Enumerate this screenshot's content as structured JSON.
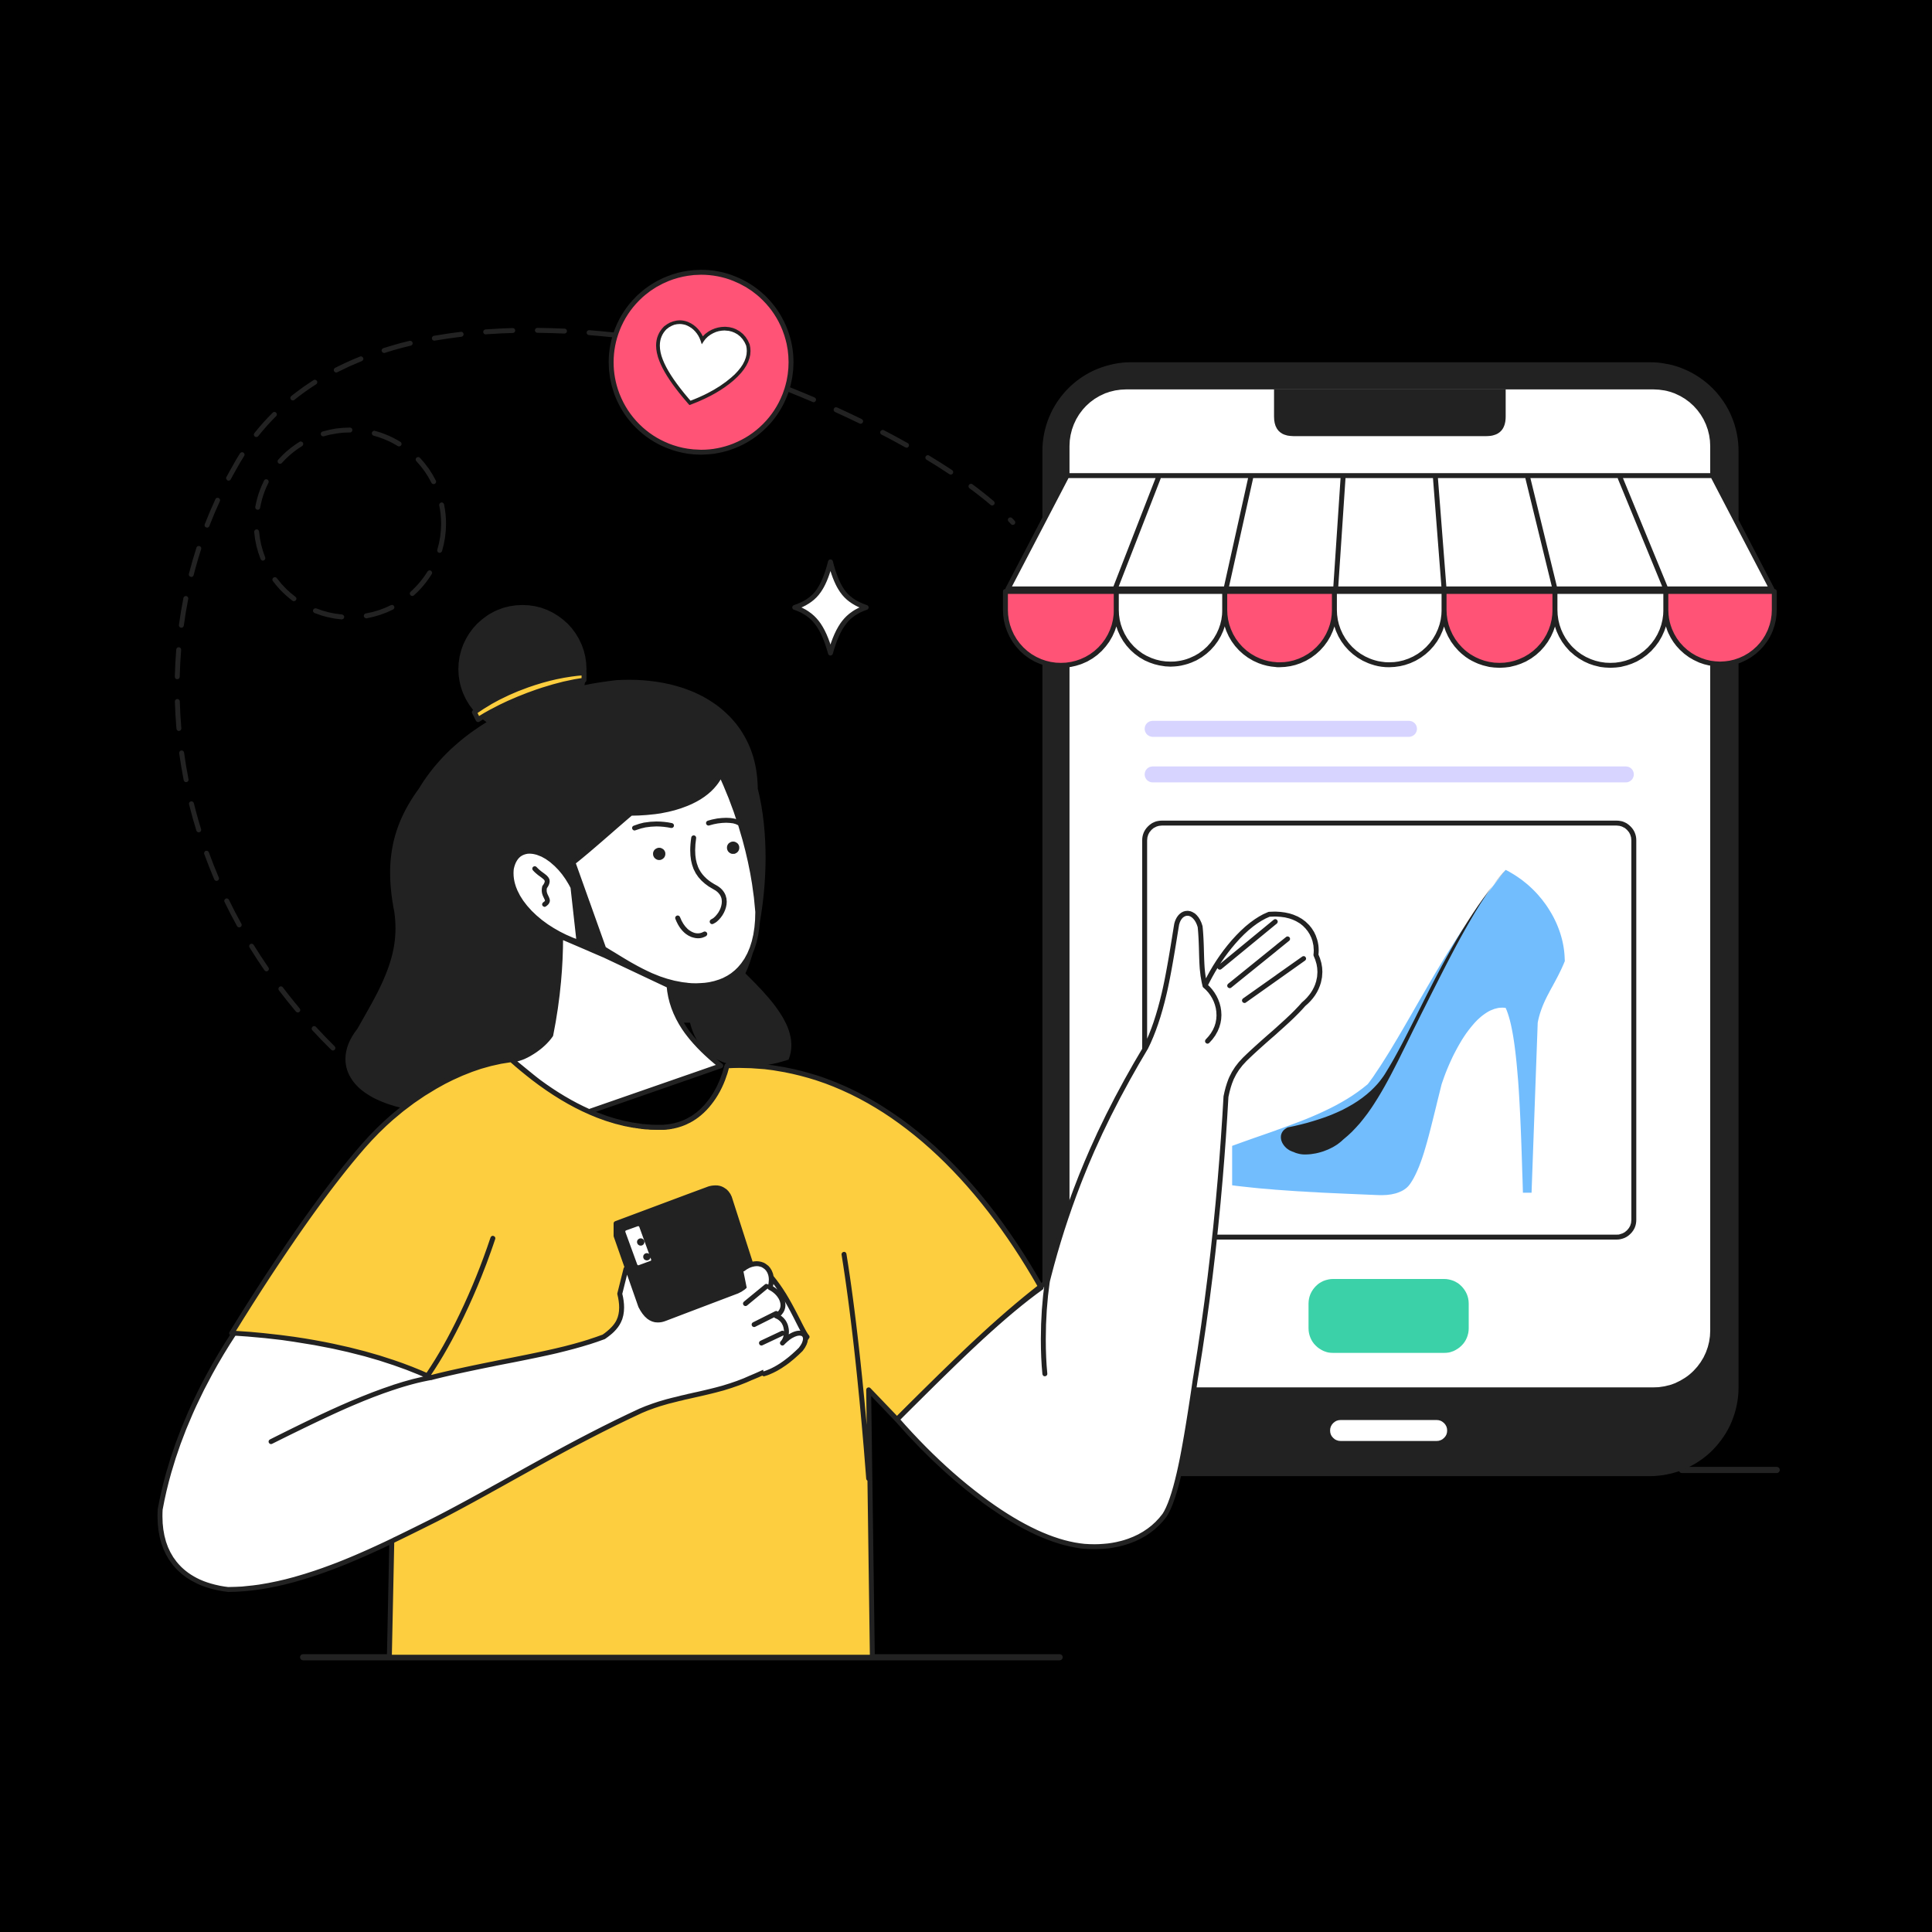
{
  "scene": {
    "kind": "online-shopping-illustration",
    "description_icons": [
      "heart-icon",
      "sparkle-icon",
      "high-heel-shoe-icon",
      "smartphone-icon",
      "awning-icon"
    ]
  },
  "colors": {
    "background": "#000000",
    "outline": "#222222",
    "white": "#ffffff",
    "shirt_yellow": "#FDCE3F",
    "accent_pink": "#FF5376",
    "shoe_blue": "#72BDFD",
    "button_green": "#3BD1A8",
    "text_line_lavender": "#D7D4FF",
    "hair": "#222222"
  }
}
